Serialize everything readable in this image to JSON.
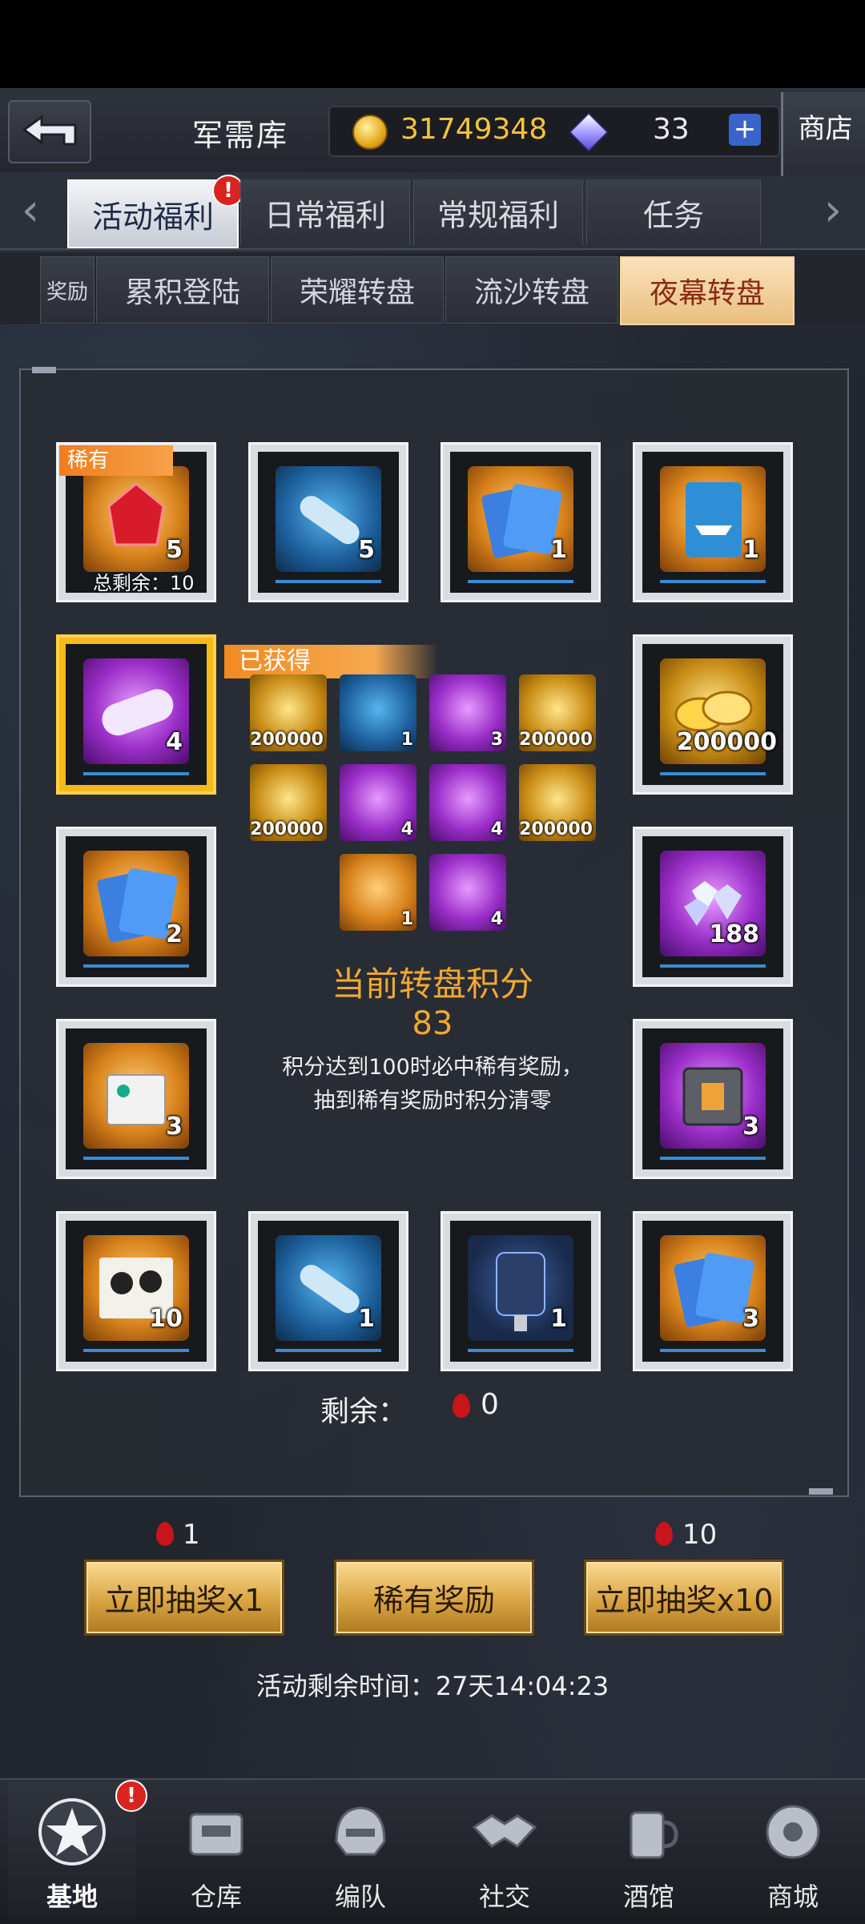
{
  "header": {
    "title": "军需库",
    "coins": "31749348",
    "gems": "33",
    "plus": "+",
    "shop_label": "商店"
  },
  "tabs_primary": [
    {
      "label": "活动福利",
      "active": true,
      "alert": "!"
    },
    {
      "label": "日常福利",
      "active": false
    },
    {
      "label": "常规福利",
      "active": false
    },
    {
      "label": "任务",
      "active": false
    }
  ],
  "tabs_secondary": [
    {
      "label": "奖励",
      "active": false
    },
    {
      "label": "累积登陆",
      "active": false
    },
    {
      "label": "荣耀转盘",
      "active": false
    },
    {
      "label": "流沙转盘",
      "active": false
    },
    {
      "label": "夜幕转盘",
      "active": true
    }
  ],
  "wheel": {
    "rare_tag": "稀有",
    "total_left": "总剩余：10",
    "items": [
      {
        "icon": "red-crystal-icon",
        "qty": "5",
        "color": "orange"
      },
      {
        "icon": "blue-tube-icon",
        "qty": "5",
        "color": "blue"
      },
      {
        "icon": "diamond-card-icon",
        "qty": "1",
        "color": "orange"
      },
      {
        "icon": "ship-card-icon",
        "qty": "1",
        "color": "orange"
      },
      {
        "icon": "purple-capsule-icon",
        "qty": "4",
        "color": "purple"
      },
      {
        "icon": "gold-coins-icon",
        "qty": "200000",
        "color": "gold"
      },
      {
        "icon": "diamond-card-icon",
        "qty": "2",
        "color": "orange"
      },
      {
        "icon": "diamond-pile-icon",
        "qty": "188",
        "color": "purple"
      },
      {
        "icon": "white-chest-icon",
        "qty": "3",
        "color": "orange"
      },
      {
        "icon": "purple-crate-icon",
        "qty": "3",
        "color": "purple"
      },
      {
        "icon": "silhouette-card-icon",
        "qty": "10",
        "color": "orange"
      },
      {
        "icon": "blue-tube-icon",
        "qty": "1",
        "color": "blue"
      },
      {
        "icon": "coating-can-icon",
        "qty": "1",
        "color": "navy"
      },
      {
        "icon": "diamond-card-icon",
        "qty": "3",
        "color": "orange"
      }
    ]
  },
  "obtained": {
    "label": "已获得",
    "items": [
      {
        "icon": "gold-coins-icon",
        "qty": "200000",
        "color": "gold"
      },
      {
        "icon": "blue-tube-icon",
        "qty": "1",
        "color": "blue"
      },
      {
        "icon": "purple-crate-icon",
        "qty": "3",
        "color": "purple"
      },
      {
        "icon": "gold-coins-icon",
        "qty": "200000",
        "color": "gold"
      },
      {
        "icon": "gold-coins-icon",
        "qty": "200000",
        "color": "gold"
      },
      {
        "icon": "purple-capsule-icon",
        "qty": "4",
        "color": "purple"
      },
      {
        "icon": "purple-capsule-icon",
        "qty": "4",
        "color": "purple"
      },
      {
        "icon": "gold-coins-icon",
        "qty": "200000",
        "color": "gold"
      },
      {
        "icon": "ship-card-icon",
        "qty": "1",
        "color": "orange"
      },
      {
        "icon": "purple-capsule-icon",
        "qty": "4",
        "color": "purple"
      }
    ]
  },
  "score": {
    "title": "当前转盘积分",
    "value": "83",
    "desc_line1": "积分达到100时必中稀有奖励，",
    "desc_line2": "抽到稀有奖励时积分清零"
  },
  "remain": {
    "label": "剩余：",
    "value": "0"
  },
  "actions": {
    "cost_single": "1",
    "cost_ten": "10",
    "draw_once": "立即抽奖x1",
    "rare_reward": "稀有奖励",
    "draw_ten": "立即抽奖x10"
  },
  "timer": "活动剩余时间：27天14:04:23",
  "bottom_nav": [
    {
      "label": "基地",
      "active": true,
      "alert": "!"
    },
    {
      "label": "仓库",
      "active": false
    },
    {
      "label": "编队",
      "active": false
    },
    {
      "label": "社交",
      "active": false
    },
    {
      "label": "酒馆",
      "active": false
    },
    {
      "label": "商城",
      "active": false
    }
  ],
  "colors": {
    "accent_gold": "#f3a831",
    "active_tab": "#e8bf80",
    "alert_red": "#d8231e"
  }
}
